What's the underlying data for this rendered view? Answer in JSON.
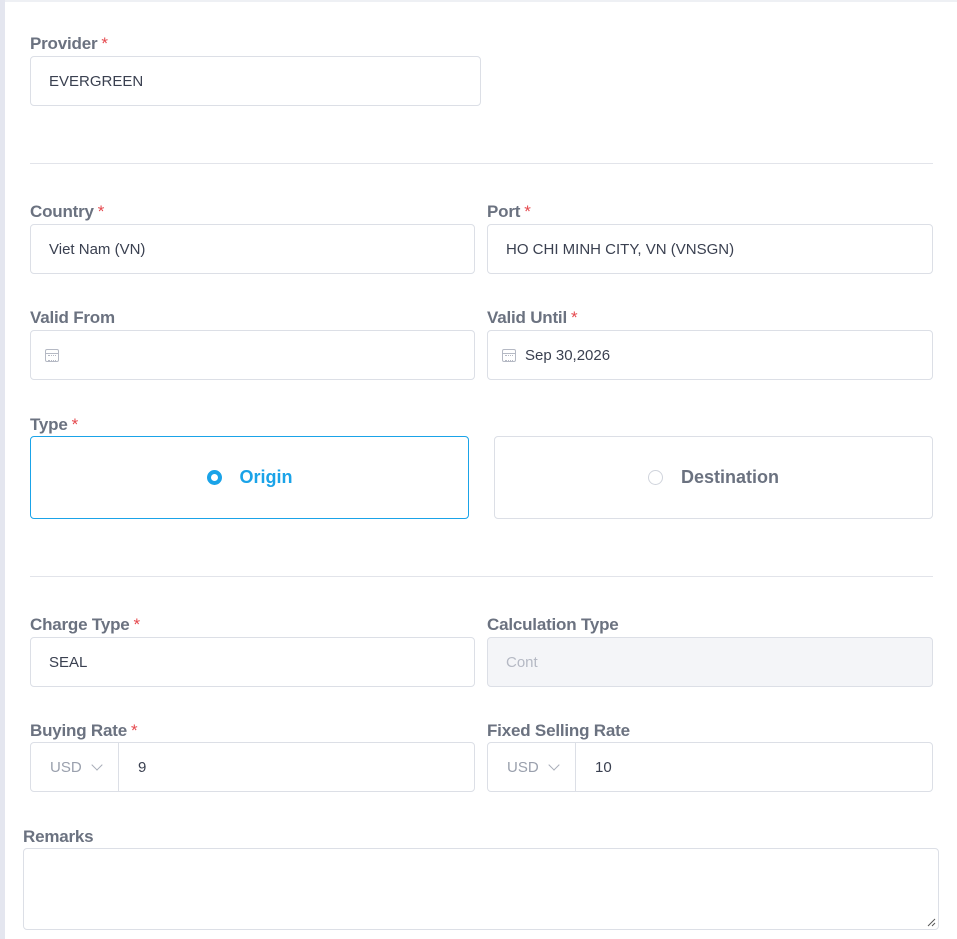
{
  "form": {
    "provider": {
      "label": "Provider",
      "required": "*",
      "value": "EVERGREEN"
    },
    "country": {
      "label": "Country",
      "required": "*",
      "value": "Viet Nam (VN)"
    },
    "port": {
      "label": "Port",
      "required": "*",
      "value": "HO CHI MINH CITY, VN (VNSGN)"
    },
    "valid_from": {
      "label": "Valid From",
      "value": ""
    },
    "valid_until": {
      "label": "Valid Until",
      "required": "*",
      "value": "Sep 30,2026"
    },
    "type": {
      "label": "Type",
      "required": "*",
      "options": [
        {
          "label": "Origin",
          "selected": true
        },
        {
          "label": "Destination",
          "selected": false
        }
      ]
    },
    "charge_type": {
      "label": "Charge Type",
      "required": "*",
      "value": "SEAL"
    },
    "calculation_type": {
      "label": "Calculation Type",
      "placeholder": "Cont"
    },
    "buying_rate": {
      "label": "Buying Rate",
      "required": "*",
      "currency": "USD",
      "value": "9"
    },
    "fixed_selling_rate": {
      "label": "Fixed Selling Rate",
      "currency": "USD",
      "value": "10"
    },
    "remarks": {
      "label": "Remarks",
      "value": ""
    }
  },
  "icons": {
    "calendar": "calendar-icon",
    "chevron": "chevron-down-icon",
    "radio": "radio-icon"
  },
  "colors": {
    "accent": "#1aa3e8",
    "required": "#e5484d",
    "disabled_bg": "#f4f5f8"
  }
}
